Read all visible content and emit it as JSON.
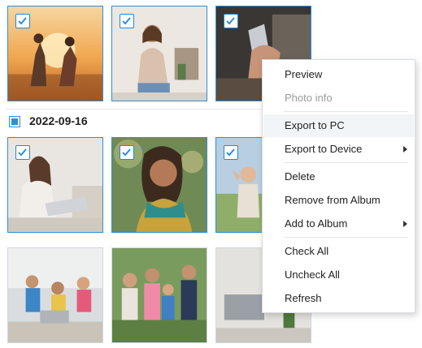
{
  "grid": {
    "row1": [
      {
        "name": "photo-couple-running-sunset",
        "selected": true
      },
      {
        "name": "photo-woman-sitting-studio",
        "selected": true
      },
      {
        "name": "photo-hand-holding-phone",
        "selected": true
      }
    ],
    "group": {
      "date": "2022-09-16",
      "checked": true
    },
    "row2": [
      {
        "name": "photo-woman-laptop-sofa",
        "selected": true
      },
      {
        "name": "photo-woman-scarf-smiling",
        "selected": true
      },
      {
        "name": "photo-family-carrying-child",
        "selected": true
      }
    ],
    "row3": [
      {
        "name": "photo-office-team-celebrating",
        "selected": false
      },
      {
        "name": "photo-family-portrait-park",
        "selected": false
      },
      {
        "name": "photo-desk-laptop-plant",
        "selected": false
      }
    ]
  },
  "context_menu": {
    "items": [
      {
        "label": "Preview",
        "enabled": true,
        "submenu": false
      },
      {
        "label": "Photo info",
        "enabled": false,
        "submenu": false
      },
      {
        "label": "Export to PC",
        "enabled": true,
        "submenu": false,
        "hover": true
      },
      {
        "label": "Export to Device",
        "enabled": true,
        "submenu": true
      },
      {
        "label": "Delete",
        "enabled": true,
        "submenu": false
      },
      {
        "label": "Remove from Album",
        "enabled": true,
        "submenu": false
      },
      {
        "label": "Add to Album",
        "enabled": true,
        "submenu": true
      },
      {
        "label": "Check All",
        "enabled": true,
        "submenu": false
      },
      {
        "label": "Uncheck All",
        "enabled": true,
        "submenu": false
      },
      {
        "label": "Refresh",
        "enabled": true,
        "submenu": false
      }
    ]
  },
  "colors": {
    "accent": "#2f8fd8",
    "check_border": "#1e88e5"
  }
}
